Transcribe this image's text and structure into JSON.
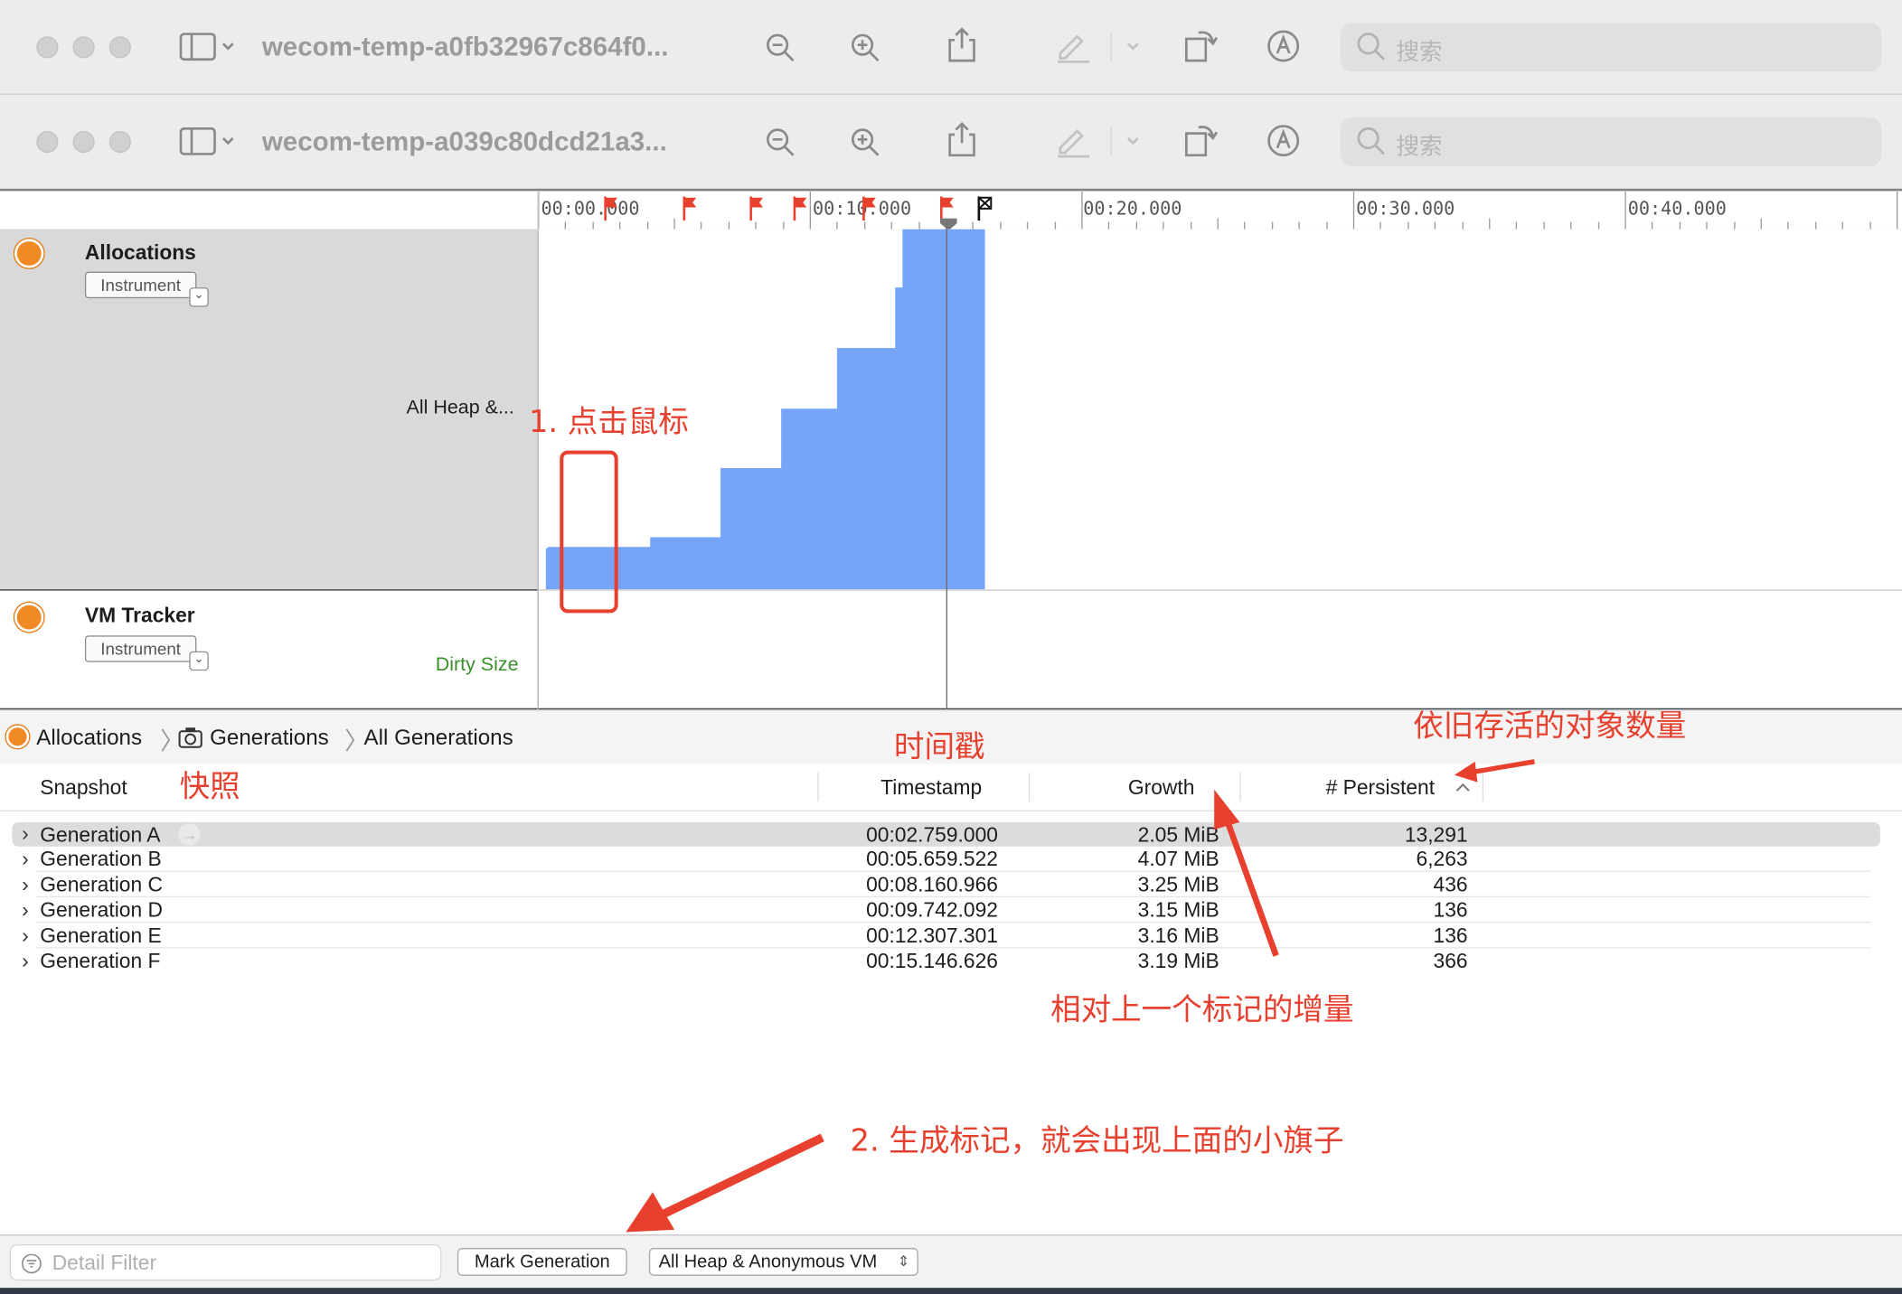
{
  "windows": [
    {
      "title": "wecom-temp-a0fb32967c864f0...",
      "search_placeholder": "搜索"
    },
    {
      "title": "wecom-temp-a039c80dcd21a3...",
      "search_placeholder": "搜索"
    }
  ],
  "timeline": {
    "ticks": [
      "00:00.000",
      "00:10.000",
      "00:20.000",
      "00:30.000",
      "00:40.000"
    ]
  },
  "instruments": [
    {
      "name": "Allocations",
      "button": "Instrument",
      "track_label": "All Heap &...",
      "track_label_color": "#1d1d1f"
    },
    {
      "name": "VM Tracker",
      "button": "Instrument",
      "track_label": "Dirty Size",
      "track_label_color": "#3a8f2c"
    }
  ],
  "breadcrumb": [
    "Allocations",
    "Generations",
    "All Generations"
  ],
  "table": {
    "headers": [
      "Snapshot",
      "Timestamp",
      "Growth",
      "# Persistent"
    ],
    "rows": [
      {
        "snapshot": "Generation A",
        "timestamp": "00:02.759.000",
        "growth": "2.05 MiB",
        "persistent": "13,291"
      },
      {
        "snapshot": "Generation B",
        "timestamp": "00:05.659.522",
        "growth": "4.07 MiB",
        "persistent": "6,263"
      },
      {
        "snapshot": "Generation C",
        "timestamp": "00:08.160.966",
        "growth": "3.25 MiB",
        "persistent": "436"
      },
      {
        "snapshot": "Generation D",
        "timestamp": "00:09.742.092",
        "growth": "3.15 MiB",
        "persistent": "136"
      },
      {
        "snapshot": "Generation E",
        "timestamp": "00:12.307.301",
        "growth": "3.16 MiB",
        "persistent": "136"
      },
      {
        "snapshot": "Generation F",
        "timestamp": "00:15.146.626",
        "growth": "3.19 MiB",
        "persistent": "366"
      }
    ]
  },
  "bottom": {
    "filter_placeholder": "Detail Filter",
    "mark_button": "Mark Generation",
    "scope_select": "All Heap & Anonymous VM"
  },
  "annotations": {
    "click_mouse": "1. 点击鼠标",
    "timestamp": "时间戳",
    "persistent": "依旧存活的对象数量",
    "snapshot": "快照",
    "growth": "相对上一个标记的增量",
    "mark": "2. 生成标记，就会出现上面的小旗子"
  },
  "colors": {
    "accent": "#e8402f",
    "graph": "#76a4f7",
    "badge": "#f08a24"
  }
}
